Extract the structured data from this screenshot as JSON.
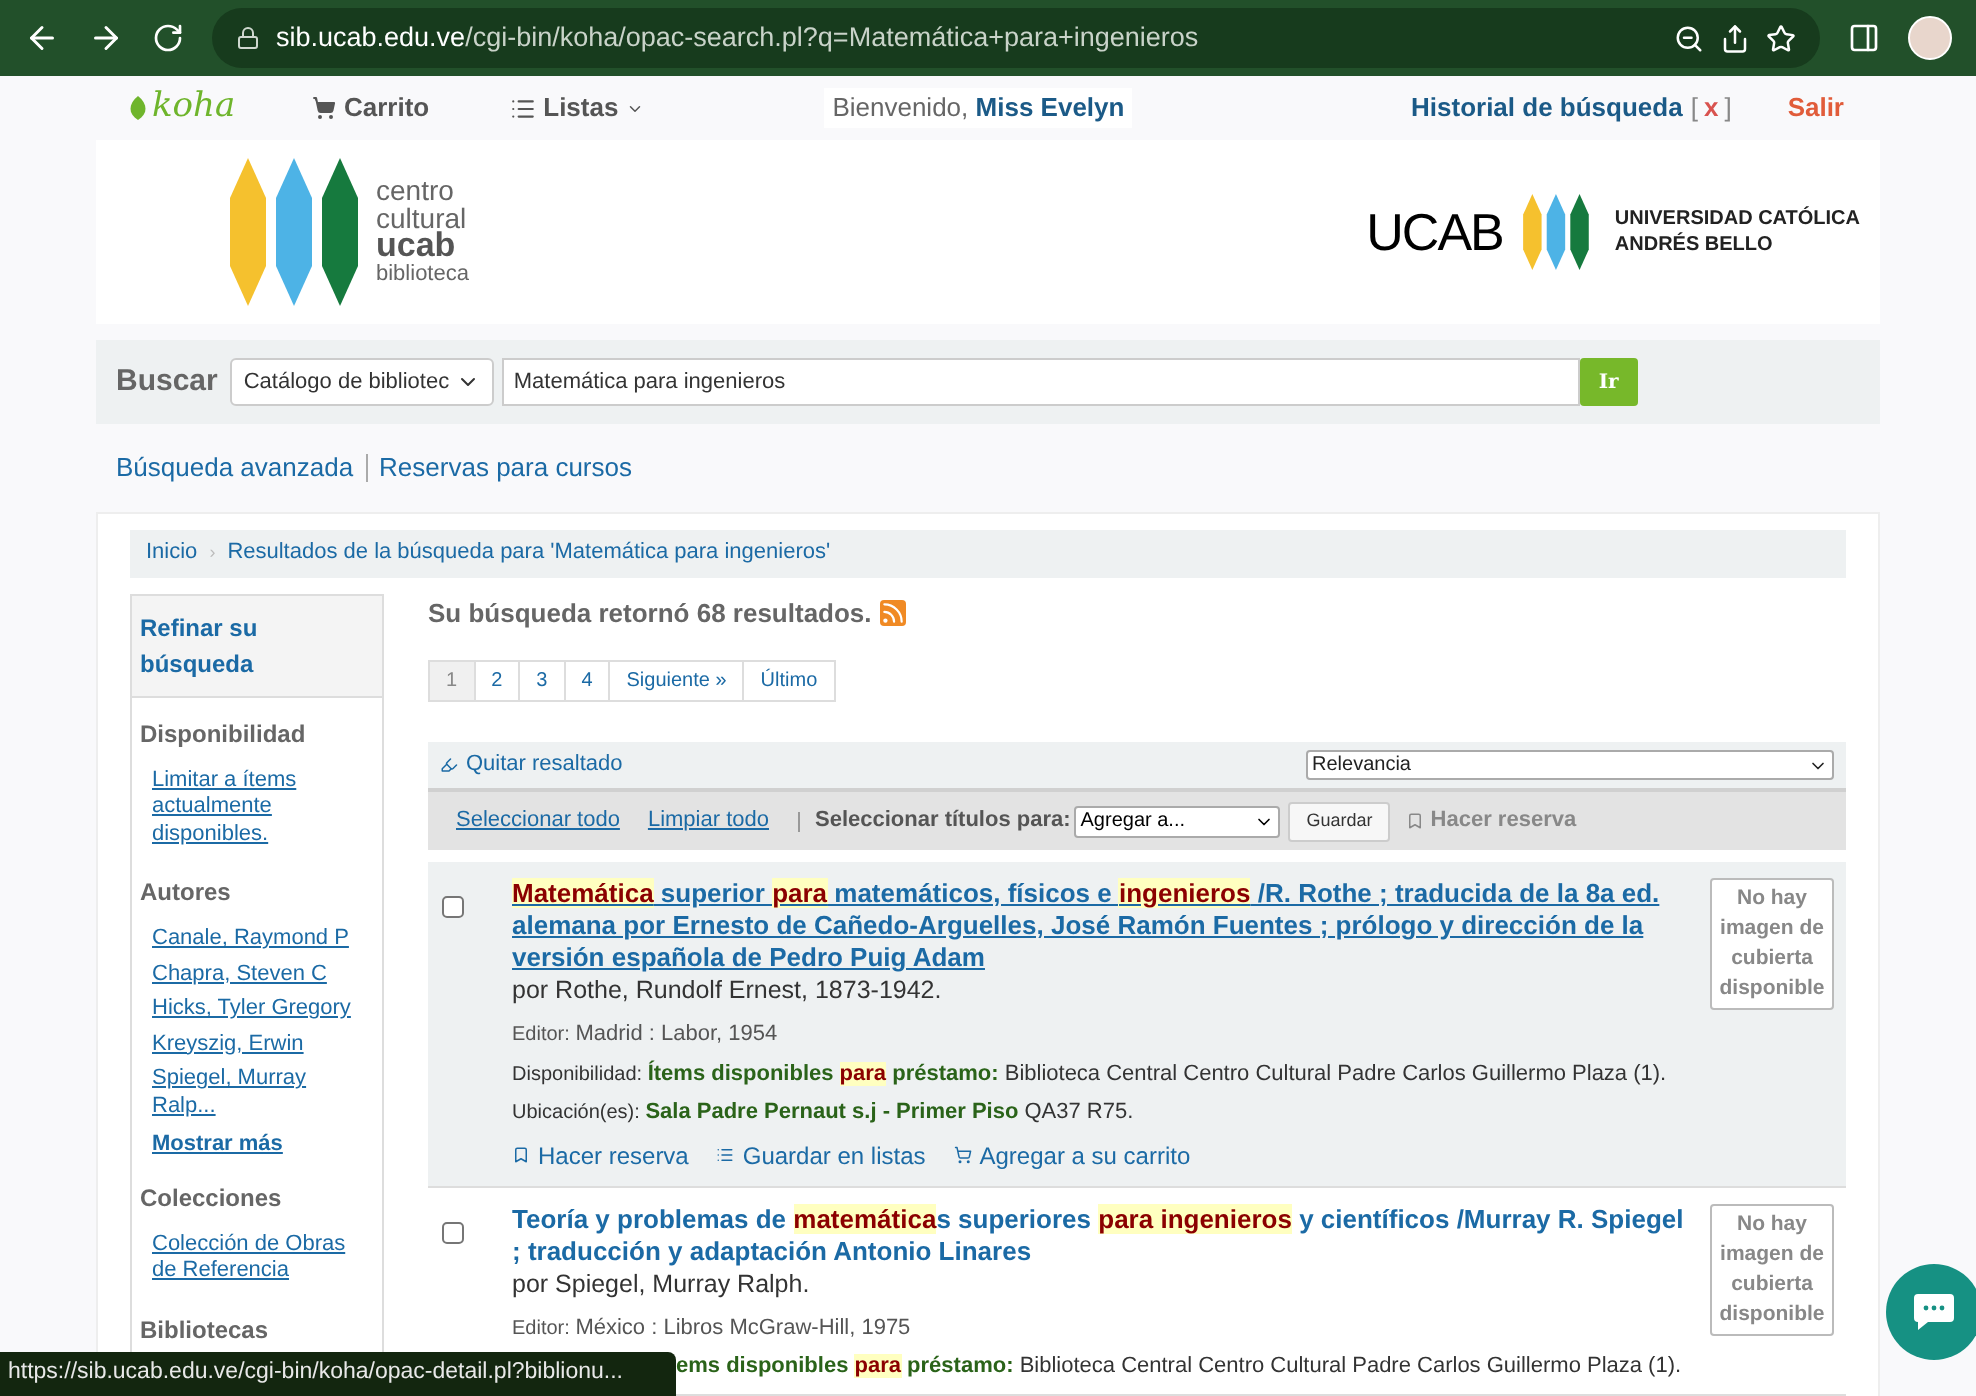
{
  "browser": {
    "url_host": "sib.ucab.edu.ve",
    "url_path": "/cgi-bin/koha/opac-search.pl?q=Matemática+para+ingenieros"
  },
  "topbar": {
    "logo": "koha",
    "cart": "Carrito",
    "lists": "Listas",
    "welcome": "Bienvenido,",
    "user": "Miss Evelyn",
    "history": "Historial de búsqueda",
    "history_open": "[",
    "history_clear": "x",
    "history_close": "]",
    "logout": "Salir"
  },
  "banner": {
    "left_logo_lines": [
      "centro",
      "cultural",
      "ucab",
      "biblioteca"
    ],
    "right_logo_word": "UCAB",
    "right_logo_lines": [
      "UNIVERSIDAD CATÓLICA",
      "ANDRÉS BELLO"
    ]
  },
  "search": {
    "label": "Buscar",
    "scope": "Catálogo de bibliotec",
    "query": "Matemática para ingenieros",
    "button": "Ir"
  },
  "links": [
    "Búsqueda avanzada",
    "Reservas para cursos"
  ],
  "breadcrumb_separator": "›",
  "breadcrumb": [
    "Inicio",
    "Resultados de la búsqueda para 'Matemática para ingenieros'"
  ],
  "sidebar": {
    "title": "Refinar su búsqueda",
    "sections": [
      {
        "heading": "Disponibilidad",
        "items": [
          "Limitar a ítems actualmente disponibles."
        ]
      },
      {
        "heading": "Autores",
        "items": [
          "Canale, Raymond P",
          "Chapra, Steven C",
          "Hicks, Tyler Gregory",
          "Kreyszig, Erwin",
          "Spiegel, Murray Ralp..."
        ],
        "more": "Mostrar más"
      },
      {
        "heading": "Colecciones",
        "items": [
          "Colección de Obras de Referencia"
        ]
      },
      {
        "heading": "Bibliotecas"
      }
    ]
  },
  "summary": "Su búsqueda retornó 68 resultados.",
  "pagination": [
    {
      "label": "1",
      "selected": true
    },
    {
      "label": "2",
      "selected": false
    },
    {
      "label": "3",
      "selected": false
    },
    {
      "label": "4",
      "selected": false
    },
    {
      "label": "Siguiente »",
      "selected": false
    },
    {
      "label": "Último",
      "selected": false
    }
  ],
  "toolbar": {
    "unhighlight": "Quitar resaltado",
    "sort": "Relevancia",
    "select_all": "Seleccionar todo",
    "clear_all": "Limpiar todo",
    "select_titles": "Seleccionar títulos para:",
    "add_to": "Agregar a...",
    "save": "Guardar",
    "hold": "Hacer reserva"
  },
  "results": [
    {
      "checked": false,
      "hovered": true,
      "title": [
        {
          "text": "Matemática",
          "highlight": true
        },
        {
          "text": " superior ",
          "highlight": false
        },
        {
          "text": "para",
          "highlight": true
        },
        {
          "text": " matemáticos, físicos e ",
          "highlight": false
        },
        {
          "text": "ingenieros",
          "highlight": true
        },
        {
          "text": " /R. Rothe ; traducida de la 8a ed. alemana por Ernesto de Cañedo-Arguelles, José Ramón Fuentes ; prólogo y dirección de la versión española de Pedro Puig Adam",
          "highlight": false
        }
      ],
      "author": "por Rothe, Rundolf Ernest, 1873-1942.",
      "publisher_label": "Editor:",
      "publisher": "Madrid : Labor, 1954",
      "availability": {
        "label": "Disponibilidad:",
        "status": [
          {
            "text": "Ítems disponibles ",
            "highlight": false
          },
          {
            "text": "para",
            "highlight": true
          },
          {
            "text": " préstamo:",
            "highlight": false
          }
        ],
        "detail": "Biblioteca Central Centro Cultural Padre Carlos Guillermo Plaza (1)."
      },
      "location": {
        "label": "Ubicación(es):",
        "place": "Sala Padre Pernaut s.j - Primer Piso",
        "call_number": "QA37 R75."
      },
      "actions": [
        "Hacer reserva",
        "Guardar en listas",
        "Agregar a su carrito"
      ],
      "cover": "No hay imagen de cubierta disponible"
    },
    {
      "checked": false,
      "hovered": false,
      "title": [
        {
          "text": "Teoría y problemas de ",
          "highlight": false
        },
        {
          "text": "matemática",
          "highlight": true
        },
        {
          "text": "s superiores ",
          "highlight": false
        },
        {
          "text": "para ",
          "highlight": true
        },
        {
          "text": "ingenieros",
          "highlight": true
        },
        {
          "text": " y científicos /Murray R. Spiegel ; traducción y adaptación Antonio Linares",
          "highlight": false
        }
      ],
      "author": "por Spiegel, Murray Ralph.",
      "publisher_label": "Editor:",
      "publisher": "México : Libros McGraw-Hill, 1975",
      "availability": {
        "status": [
          {
            "text": "ems disponibles ",
            "highlight": false
          },
          {
            "text": "para",
            "highlight": true
          },
          {
            "text": " préstamo:",
            "highlight": false
          }
        ],
        "detail": "Biblioteca Central Centro Cultural Padre Carlos Guillermo Plaza (1)."
      },
      "cover": "No hay imagen de cubierta disponible"
    }
  ],
  "status_bar": "https://sib.ucab.edu.ve/cgi-bin/koha/opac-detail.pl?biblionu..."
}
